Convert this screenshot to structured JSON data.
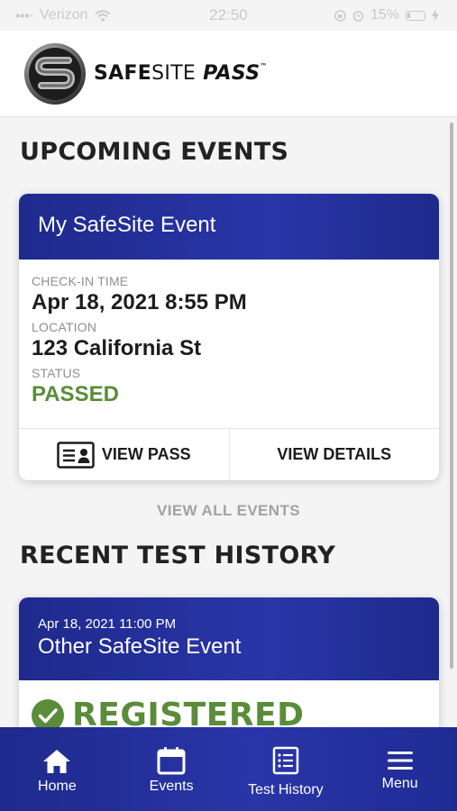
{
  "status_bar": {
    "carrier": "Verizon",
    "time": "22:50",
    "battery": "15%"
  },
  "header": {
    "brand_bold": "SAFE",
    "brand_thin": "SITE",
    "brand_italic": "PASS",
    "trademark": "™"
  },
  "upcoming": {
    "section_title": "UPCOMING EVENTS",
    "event": {
      "title": "My SafeSite Event",
      "checkin_label": "CHECK-IN TIME",
      "checkin_value": "Apr 18, 2021 8:55 PM",
      "location_label": "LOCATION",
      "location_value": "123 California St",
      "status_label": "STATUS",
      "status_value": "PASSED",
      "view_pass_label": "VIEW PASS",
      "view_details_label": "VIEW DETAILS"
    },
    "view_all_label": "VIEW ALL EVENTS"
  },
  "history": {
    "section_title": "RECENT TEST HISTORY",
    "item": {
      "date": "Apr 18, 2021 11:00 PM",
      "title": "Other SafeSite Event",
      "status": "REGISTERED"
    }
  },
  "tabs": [
    {
      "label": "Home",
      "icon": "home-icon"
    },
    {
      "label": "Events",
      "icon": "calendar-icon"
    },
    {
      "label": "Test History",
      "icon": "list-icon"
    },
    {
      "label": "Menu",
      "icon": "hamburger-icon"
    }
  ],
  "colors": {
    "brand_blue": "#1e2a8c",
    "success_green": "#5b8c3a"
  }
}
